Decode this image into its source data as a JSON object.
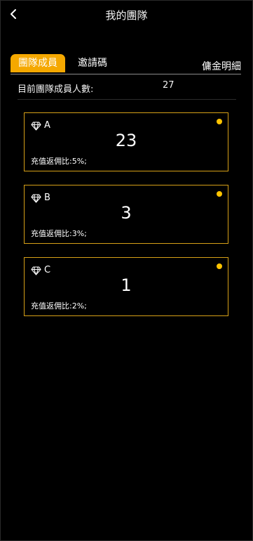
{
  "header": {
    "title": "我的團隊",
    "back_icon": "chevron-left-icon"
  },
  "tabs": [
    {
      "label": "團隊成員",
      "active": true
    },
    {
      "label": "邀請碼",
      "active": false
    }
  ],
  "commission_link": "傭金明細",
  "summary": {
    "label": "目前團隊成員人數:",
    "value": "27"
  },
  "levels": [
    {
      "icon": "diamond-icon",
      "name": "A",
      "count": "23",
      "rate": "充值返佣比:5%;"
    },
    {
      "icon": "diamond-icon",
      "name": "B",
      "count": "3",
      "rate": "充值返佣比:3%;"
    },
    {
      "icon": "diamond-icon",
      "name": "C",
      "count": "1",
      "rate": "充值返佣比:2%;"
    }
  ],
  "colors": {
    "accent": "#f5a800",
    "card_border": "#d6a017",
    "dot": "#ffc400",
    "background": "#000000"
  }
}
